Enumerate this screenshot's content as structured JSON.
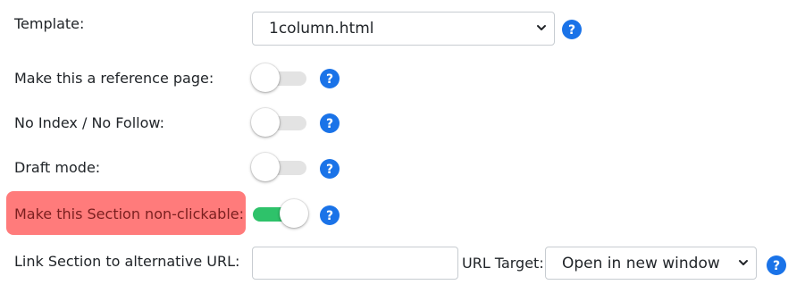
{
  "colors": {
    "accent": "#1a73e8",
    "toggle_on": "#2ec26a",
    "toggle_off": "#e3e3e3",
    "highlight": "#ff7b7b"
  },
  "template": {
    "label": "Template:",
    "value": "1column.html"
  },
  "reference_page": {
    "label": "Make this a reference page:",
    "enabled": false
  },
  "no_index": {
    "label": "No Index / No Follow:",
    "enabled": false
  },
  "draft_mode": {
    "label": "Draft mode:",
    "enabled": false
  },
  "non_clickable": {
    "label": "Make this Section non-clickable:",
    "enabled": true
  },
  "alt_url": {
    "label": "Link Section to alternative URL:",
    "value": "",
    "url_target_label": "URL Target:",
    "url_target_value": "Open in new window"
  },
  "icons": {
    "help": "question-circle-icon",
    "dropdown": "chevron-down-icon"
  }
}
